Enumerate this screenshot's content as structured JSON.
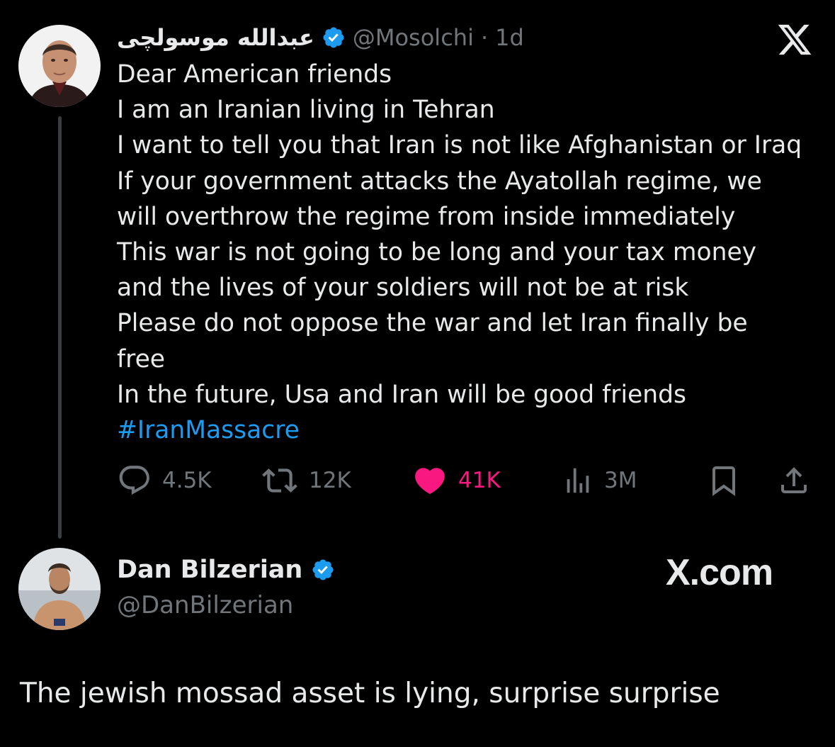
{
  "tweet": {
    "author_name": "عبدالله موسولچی",
    "handle": "@Mosolchi",
    "separator": "·",
    "time": "1d",
    "lines": [
      "Dear American friends",
      "I am an Iranian living in Tehran",
      "I want to tell you that Iran is not like Afghanistan or Iraq",
      "If your government attacks the Ayatollah regime, we",
      "will overthrow the regime from inside immediately",
      "This war is not going to be long and your tax money",
      "and the lives of your soldiers will not be at risk",
      "Please do not oppose the war and let Iran finally be",
      "free",
      "In the future, Usa and Iran will be good friends"
    ],
    "hashtag": "#IranMassacre",
    "stats": {
      "replies": "4.5K",
      "reposts": "12K",
      "likes": "41K",
      "views": "3M"
    },
    "icons": {
      "reply": "reply-icon",
      "repost": "repost-icon",
      "like": "heart-icon",
      "views": "views-icon",
      "bookmark": "bookmark-icon",
      "share": "share-icon",
      "verified": "verified-badge-icon",
      "platform": "x-logo-icon"
    },
    "colors": {
      "accent": "#1d9bf0",
      "like": "#f91880",
      "muted": "#71767b",
      "text": "#e7e9ea",
      "background": "#000000"
    }
  },
  "reply": {
    "author_name": "Dan Bilzerian",
    "handle": "@DanBilzerian",
    "brand": "X.com",
    "text": "The jewish mossad asset is lying, surprise surprise"
  }
}
